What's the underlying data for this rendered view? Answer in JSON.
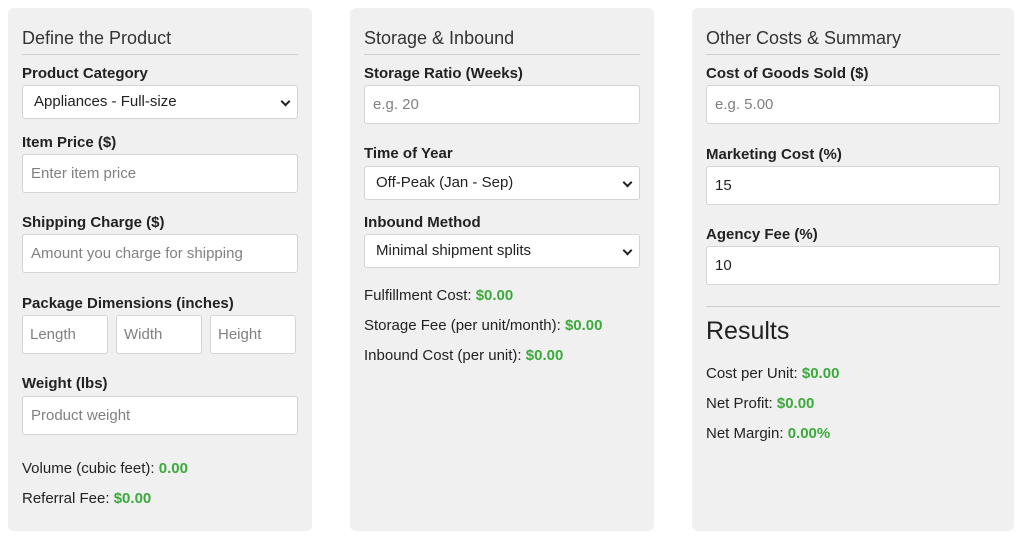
{
  "product": {
    "title": "Define the Product",
    "category_label": "Product Category",
    "category_value": "Appliances - Full-size",
    "item_price_label": "Item Price ($)",
    "item_price_placeholder": "Enter item price",
    "shipping_label": "Shipping Charge ($)",
    "shipping_placeholder": "Amount you charge for shipping",
    "dimensions_label": "Package Dimensions (inches)",
    "length_placeholder": "Length",
    "width_placeholder": "Width",
    "height_placeholder": "Height",
    "weight_label": "Weight (lbs)",
    "weight_placeholder": "Product weight",
    "volume_label": "Volume (cubic feet):",
    "volume_value": "0.00",
    "referral_label": "Referral Fee:",
    "referral_value": "$0.00"
  },
  "storage": {
    "title": "Storage & Inbound",
    "ratio_label": "Storage Ratio (Weeks)",
    "ratio_placeholder": "e.g. 20",
    "time_label": "Time of Year",
    "time_value": "Off-Peak (Jan - Sep)",
    "inbound_label": "Inbound Method",
    "inbound_value": "Minimal shipment splits",
    "fulfillment_label": "Fulfillment Cost:",
    "fulfillment_value": "$0.00",
    "storage_fee_label": "Storage Fee (per unit/month):",
    "storage_fee_value": "$0.00",
    "inbound_cost_label": "Inbound Cost (per unit):",
    "inbound_cost_value": "$0.00"
  },
  "summary": {
    "title": "Other Costs & Summary",
    "cogs_label": "Cost of Goods Sold ($)",
    "cogs_placeholder": "e.g. 5.00",
    "marketing_label": "Marketing Cost (%)",
    "marketing_value": "15",
    "agency_label": "Agency Fee (%)",
    "agency_value": "10",
    "results_title": "Results",
    "cost_per_unit_label": "Cost per Unit:",
    "cost_per_unit_value": "$0.00",
    "net_profit_label": "Net Profit:",
    "net_profit_value": "$0.00",
    "net_margin_label": "Net Margin:",
    "net_margin_value": "0.00%"
  },
  "colors": {
    "positive": "#3aaa3a",
    "panel_bg": "#f0f0f0"
  },
  "icons": {
    "select_arrow": "chevron-down-icon"
  }
}
